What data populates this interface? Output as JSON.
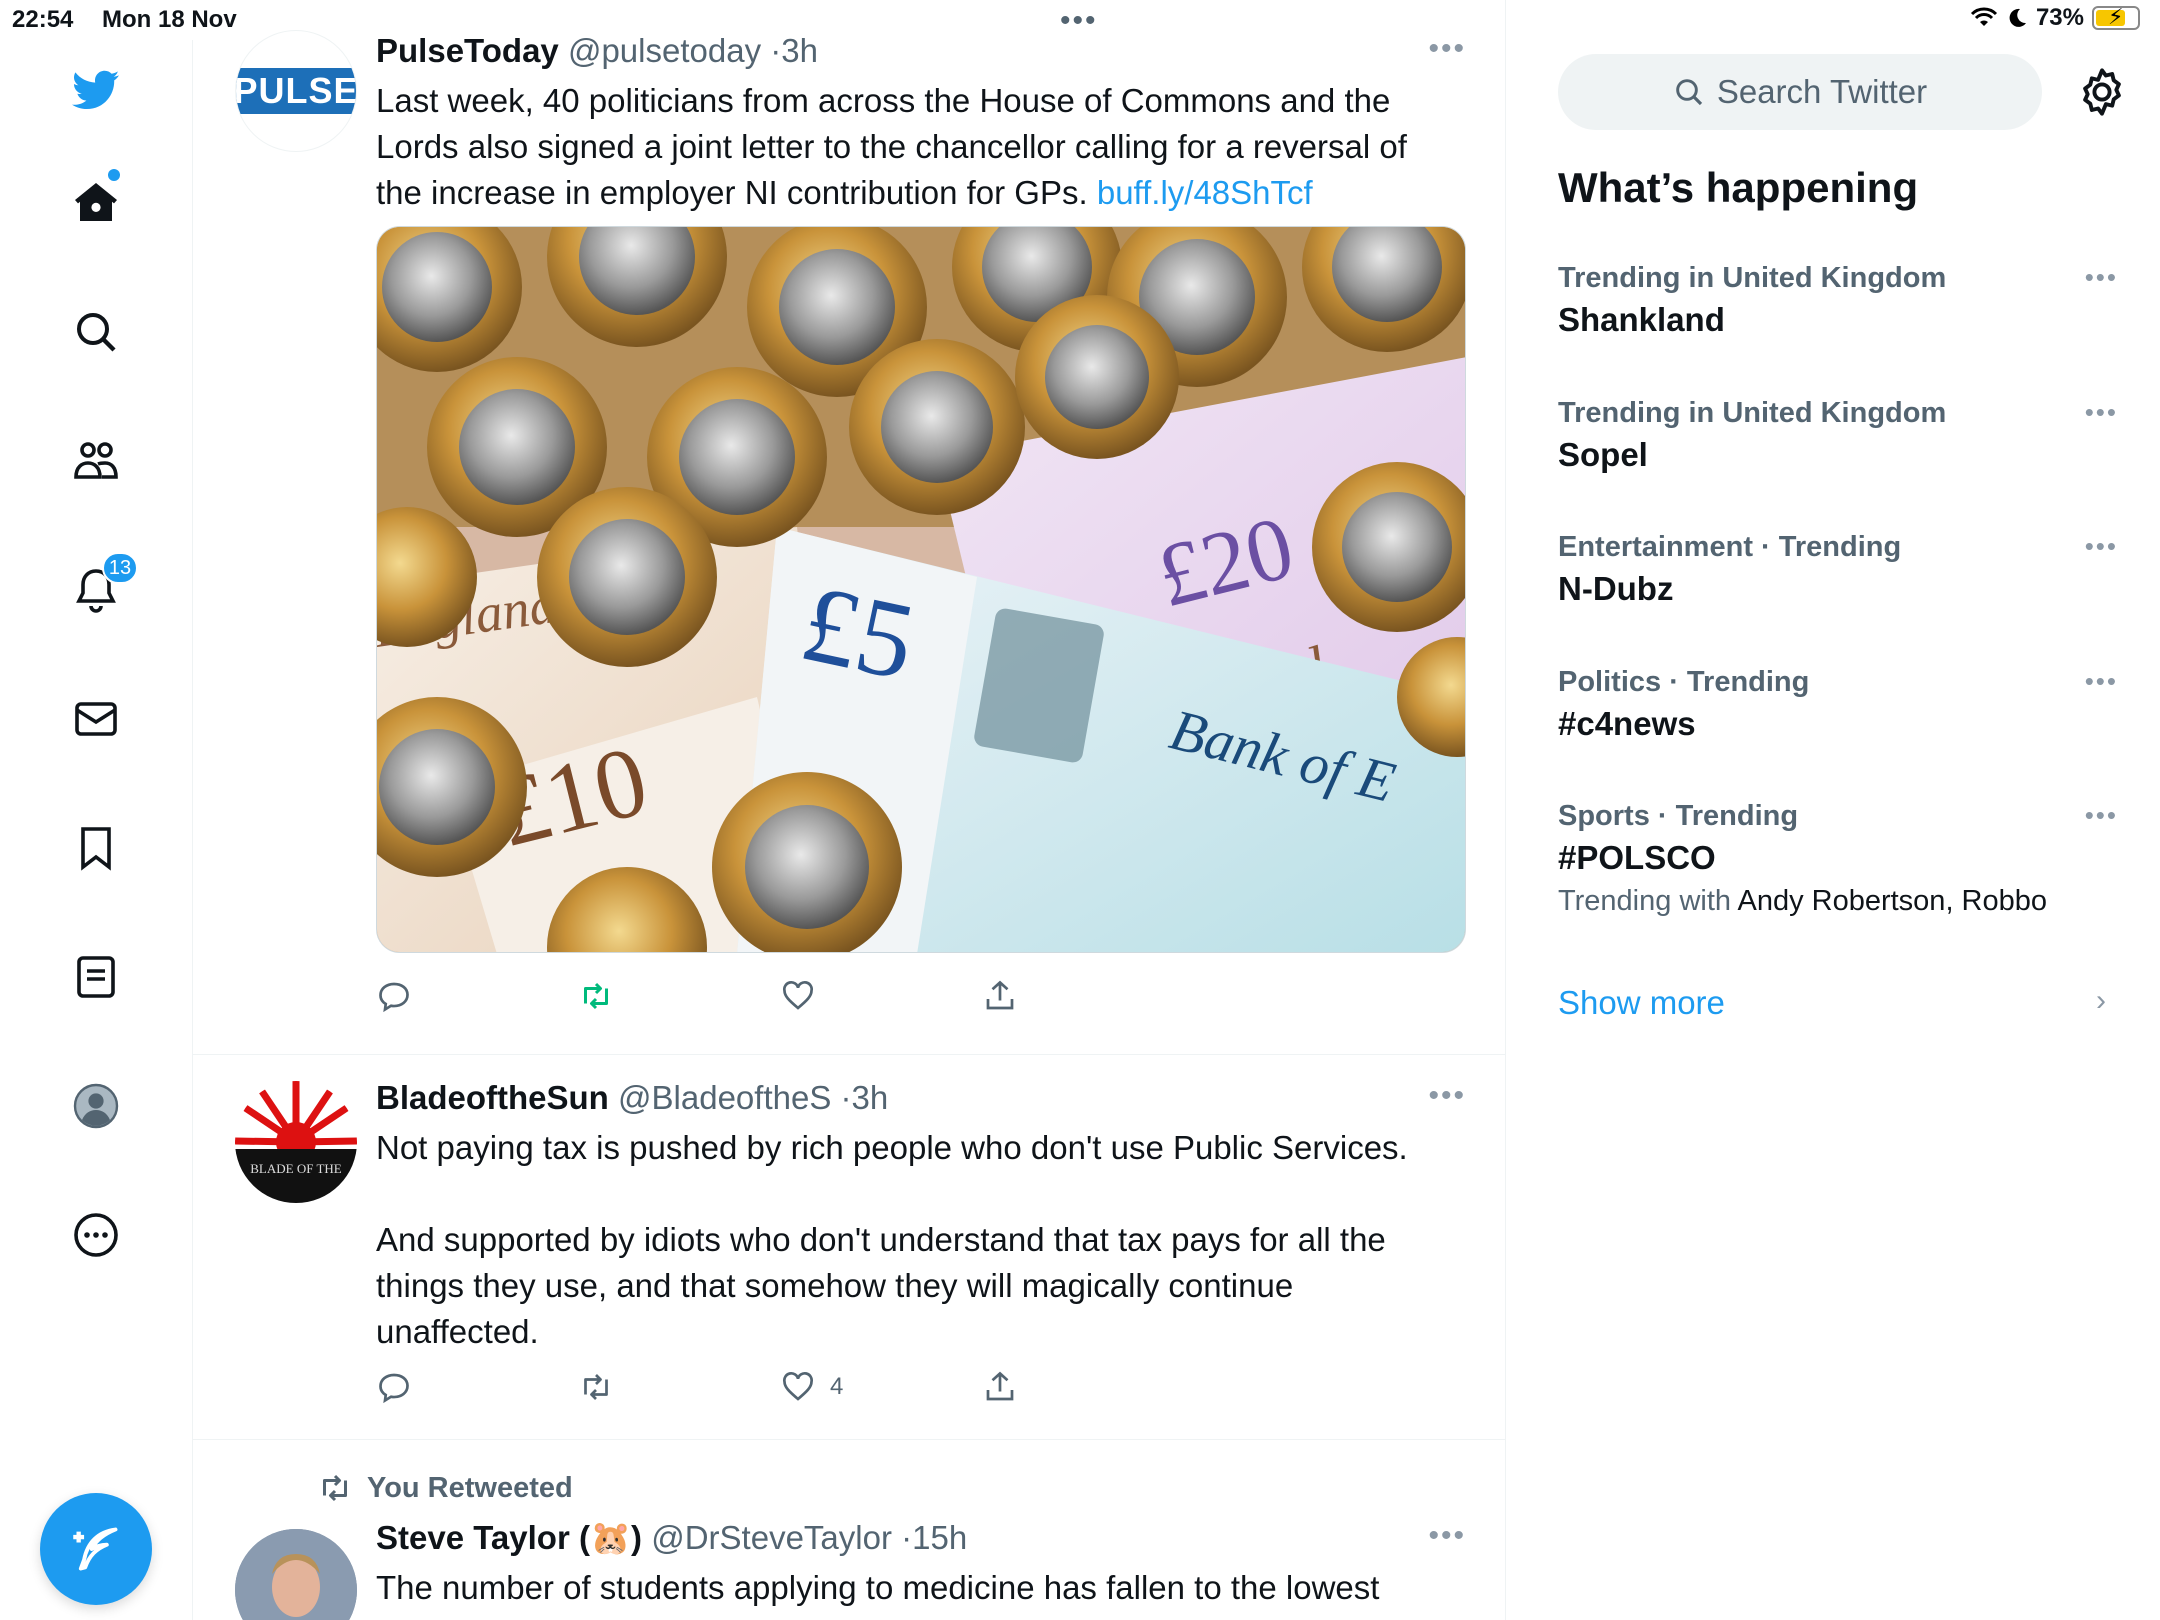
{
  "status_bar": {
    "time": "22:54",
    "date": "Mon 18 Nov",
    "battery": "73%",
    "battery_level": 0.73
  },
  "nav": {
    "notifications_badge": "13"
  },
  "tweets": [
    {
      "name": "PulseToday",
      "handle": "@pulsetoday",
      "time": "3h",
      "avatar_text": "PULSE",
      "text": "Last week, 40 politicians from across the House of Commons and the Lords also signed a joint letter to the chancellor calling for a reversal of the increase in employer NI contribution for GPs.",
      "link": "buff.ly/48ShTcf",
      "image_labels": {
        "ten": "£10",
        "five": "£5",
        "twenty": "£20",
        "england": "England",
        "england2": "England",
        "bank": "Bank of E"
      },
      "likes": ""
    },
    {
      "name": "BladeoftheSun",
      "handle": "@BladeoftheS",
      "time": "3h",
      "avatar_text": "BLADE OF THE",
      "text_p1": "Not paying tax is pushed by rich people who don't use Public Services.",
      "text_p2": "And supported by idiots who don't understand that tax pays for all the things they use, and that somehow they will magically continue unaffected.",
      "likes": "4"
    },
    {
      "retweet_label": "You Retweeted",
      "name": "Steve Taylor (🐹)",
      "handle": "@DrSteveTaylor",
      "time": "15h",
      "text": "The number of students applying to medicine has fallen to the lowest"
    }
  ],
  "sidebar": {
    "search_placeholder": "Search Twitter",
    "title": "What’s happening",
    "trends": [
      {
        "category": "Trending in United Kingdom",
        "name": "Shankland"
      },
      {
        "category": "Trending in United Kingdom",
        "name": "Sopel"
      },
      {
        "category": "Entertainment · Trending",
        "name": "N-Dubz"
      },
      {
        "category": "Politics · Trending",
        "name": "#c4news"
      },
      {
        "category": "Sports · Trending",
        "name": "#POLSCO",
        "with_label": "Trending with",
        "with_names": "Andy Robertson, Robbo"
      }
    ],
    "show_more": "Show more"
  },
  "colors": {
    "accent": "#1d9bf0",
    "retweet_green": "#00ba7c",
    "muted": "#536471"
  }
}
